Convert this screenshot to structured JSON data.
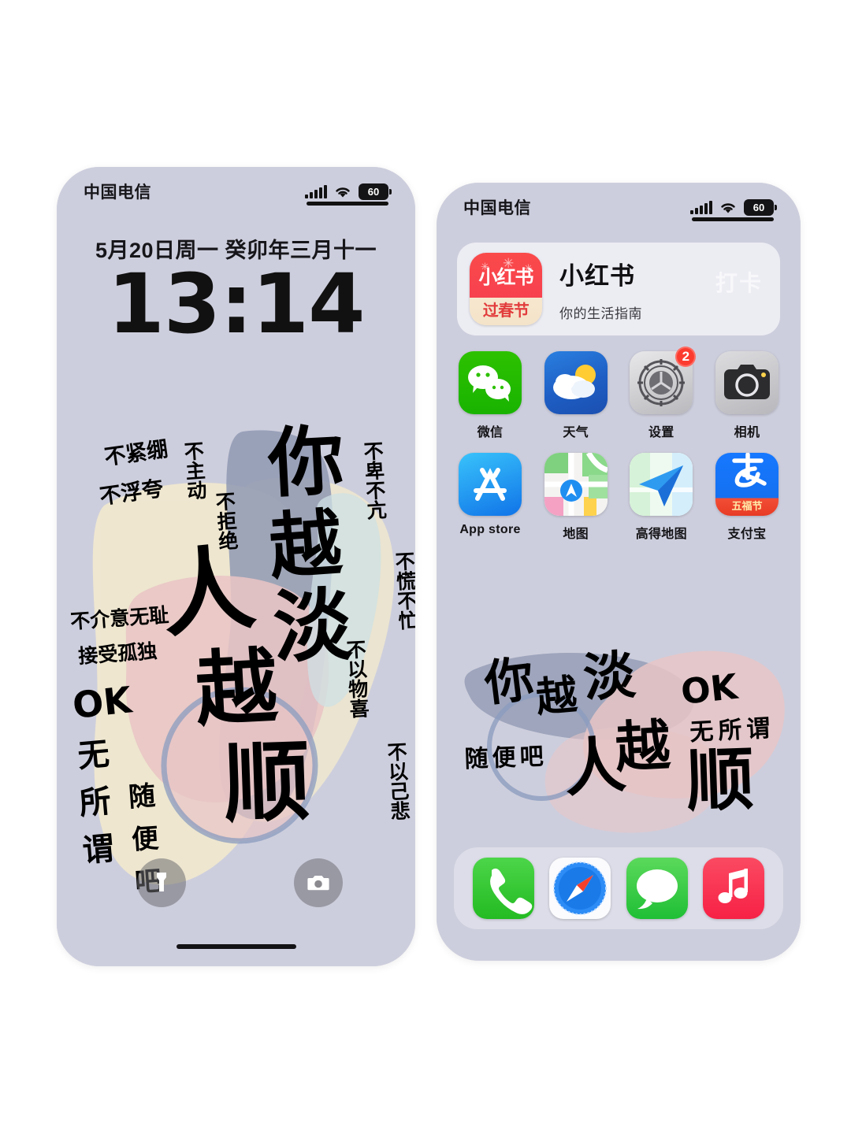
{
  "page": {
    "background": "#ffffff",
    "wallpaper_base": "#cdcedd",
    "palette": {
      "cream": "#f0e8cf",
      "pink": "#eac4c4",
      "slate": "#8d96b0",
      "ink": "#14130f",
      "accent_red": "#fc3b2f"
    }
  },
  "lock_screen": {
    "status_bar": {
      "carrier": "中国电信",
      "signal_icon": "signal-bars-icon",
      "wifi_icon": "wifi-icon",
      "battery_level": "60"
    },
    "date": "5月20日周一  癸卯年三月十一",
    "time": "13:14",
    "flashlight_icon": "flashlight-icon",
    "camera_icon": "camera-icon",
    "wallpaper_text": {
      "main": [
        "你",
        "越",
        "淡",
        "人",
        "越",
        "顺"
      ],
      "side_notes": [
        "不紧绷",
        "不浮夸",
        "不主动 不拒绝",
        "不卑不亢",
        "不慌不忙",
        "不介意无耻",
        "接受孤独",
        "不以物喜",
        "不以己悲",
        "OK 无所谓",
        "随便吧"
      ],
      "ok_line": "OK",
      "ok_sub": "无 所 谓",
      "casual": "随 便 吧"
    }
  },
  "home_screen": {
    "status_bar": {
      "carrier": "中国电信",
      "signal_icon": "signal-bars-icon",
      "wifi_icon": "wifi-icon",
      "battery_level": "60"
    },
    "widget": {
      "icon_top_text": "小红书",
      "icon_bottom_text": "过春节",
      "title": "小红书",
      "subtitle": "你的生活指南",
      "watermark": "打卡"
    },
    "app_rows": [
      [
        {
          "label": "微信",
          "icon": "wechat-icon",
          "badge": ""
        },
        {
          "label": "天气",
          "icon": "weather-icon",
          "badge": ""
        },
        {
          "label": "设置",
          "icon": "settings-gear-icon",
          "badge": "2"
        },
        {
          "label": "相机",
          "icon": "camera-icon",
          "badge": ""
        }
      ],
      [
        {
          "label": "App store",
          "icon": "app-store-icon",
          "badge": ""
        },
        {
          "label": "地图",
          "icon": "apple-maps-icon",
          "badge": ""
        },
        {
          "label": "高得地图",
          "icon": "amap-icon",
          "badge": ""
        },
        {
          "label": "支付宝",
          "icon": "alipay-icon",
          "badge": "",
          "banner": "五福节"
        }
      ]
    ],
    "dock": [
      {
        "label": "",
        "icon": "phone-icon"
      },
      {
        "label": "",
        "icon": "safari-compass-icon"
      },
      {
        "label": "",
        "icon": "messages-bubble-icon"
      },
      {
        "label": "",
        "icon": "music-note-icon"
      }
    ],
    "wallpaper_text": {
      "main": [
        "你",
        "越",
        "淡",
        "人",
        "越",
        "顺"
      ],
      "ok_line": "OK",
      "ok_sub": "无所谓",
      "casual": "随便吧"
    }
  }
}
